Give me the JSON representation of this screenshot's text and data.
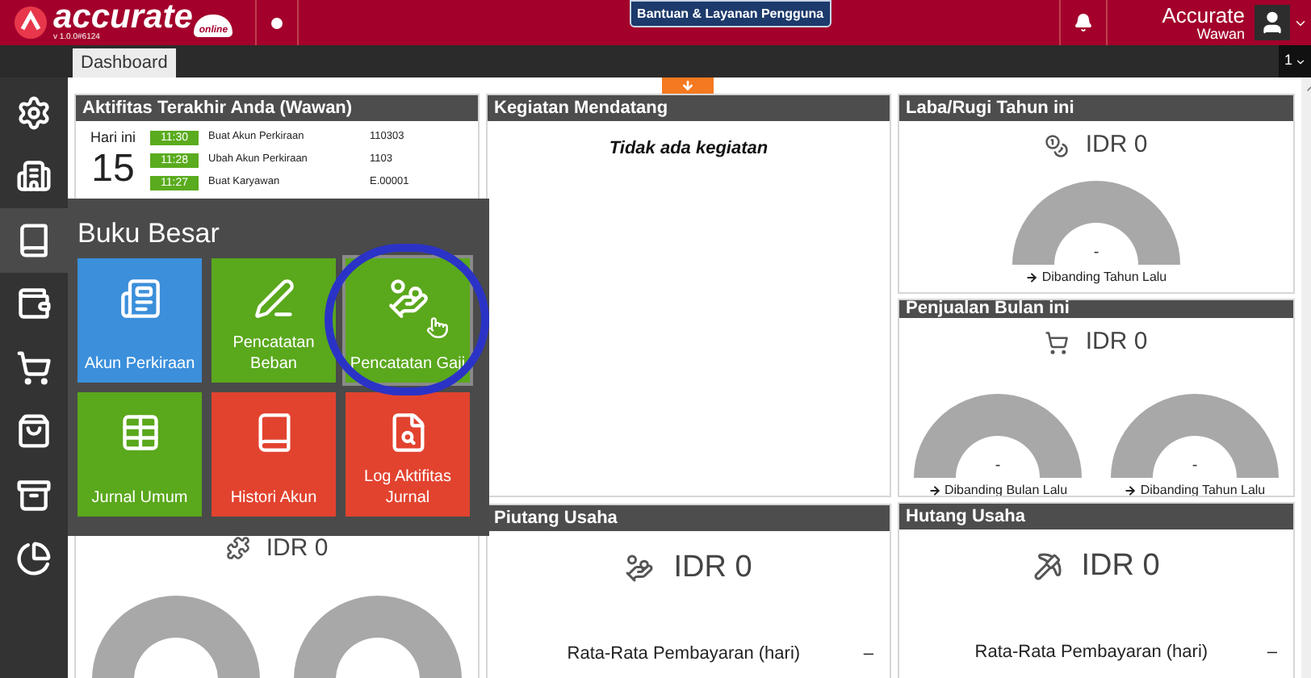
{
  "header": {
    "brand": "accurate",
    "brand_sub": "online",
    "version": "v 1.0.0#6124",
    "help_button": "Bantuan & Layanan Pengguna",
    "user_name": "Accurate",
    "user_sub": "Wawan"
  },
  "tabs": [
    {
      "label": "Dashboard",
      "selected": true
    }
  ],
  "page_selector": "1",
  "sidebar": {
    "items": [
      {
        "selected": false
      },
      {
        "selected": false
      },
      {
        "selected": true
      },
      {
        "selected": false
      },
      {
        "selected": false
      },
      {
        "selected": false
      },
      {
        "selected": false
      },
      {
        "selected": false
      }
    ]
  },
  "panels": [
    {
      "kind": "activity",
      "title": "Aktifitas Terakhir Anda (Wawan)",
      "day_label": "Hari ini",
      "day": "15",
      "entries": [
        {
          "time": "11:30",
          "action": "Buat Akun Perkiraan",
          "code": "110303"
        },
        {
          "time": "11:28",
          "action": "Ubah Akun Perkiraan",
          "code": "1103"
        },
        {
          "time": "11:27",
          "action": "Buat Karyawan",
          "code": "E.00001"
        }
      ]
    },
    {
      "kind": "events",
      "title": "Kegiatan Mendatang",
      "empty_text": "Tidak ada kegiatan"
    },
    {
      "kind": "gauges",
      "title": "Laba/Rugi Tahun ini",
      "amount": "IDR 0",
      "gauges": [
        {
          "value": "-",
          "caption": "Dibanding Tahun Lalu"
        }
      ]
    },
    {
      "kind": "gauges",
      "title": "Penjualan Bulan ini",
      "amount": "IDR 0",
      "gauges": [
        {
          "value": "-",
          "caption": "Dibanding Bulan Lalu"
        },
        {
          "value": "-",
          "caption": "Dibanding Tahun Lalu"
        }
      ]
    },
    {
      "kind": "gauges_cut",
      "amount": "IDR 0"
    },
    {
      "kind": "average",
      "title": "Piutang Usaha",
      "amount": "IDR 0",
      "metric_label": "Rata-Rata Pembayaran (hari)",
      "metric_value": "–"
    },
    {
      "kind": "average",
      "title": "Hutang Usaha",
      "amount": "IDR 0",
      "metric_label": "Rata-Rata Pembayaran (hari)",
      "metric_value": "–"
    }
  ],
  "menu": {
    "title": "Buku Besar",
    "tiles": [
      {
        "label": "Akun Perkiraan",
        "color": "#3b8fdb",
        "selected": false
      },
      {
        "label": "Pencatatan Beban",
        "color": "#5aa81c",
        "selected": false
      },
      {
        "label": "Pencatatan Gaji",
        "color": "#5aa81c",
        "selected": true
      },
      {
        "label": "Jurnal Umum",
        "color": "#5aa81c",
        "selected": false
      },
      {
        "label": "Histori Akun",
        "color": "#e2432f",
        "selected": false
      },
      {
        "label": "Log Aktifitas Jurnal",
        "color": "#e2432f",
        "selected": false
      }
    ]
  }
}
